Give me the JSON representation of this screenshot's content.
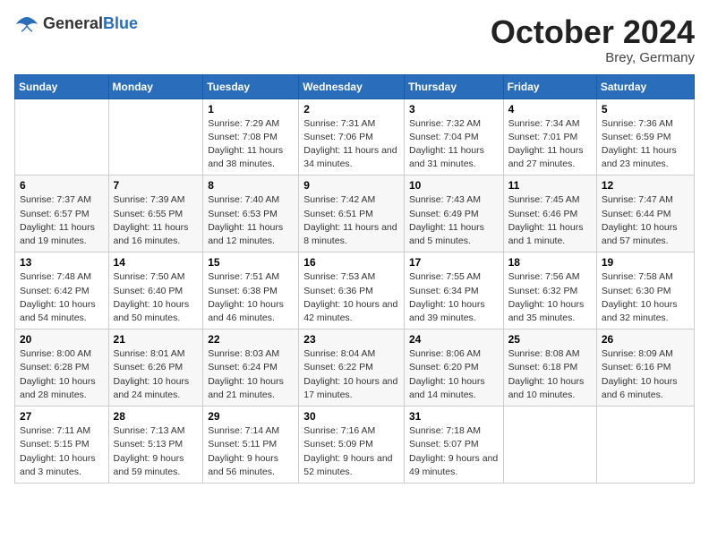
{
  "logo": {
    "text_general": "General",
    "text_blue": "Blue"
  },
  "header": {
    "month": "October 2024",
    "location": "Brey, Germany"
  },
  "weekdays": [
    "Sunday",
    "Monday",
    "Tuesday",
    "Wednesday",
    "Thursday",
    "Friday",
    "Saturday"
  ],
  "weeks": [
    [
      {
        "day": "",
        "sunrise": "",
        "sunset": "",
        "daylight": ""
      },
      {
        "day": "",
        "sunrise": "",
        "sunset": "",
        "daylight": ""
      },
      {
        "day": "1",
        "sunrise": "Sunrise: 7:29 AM",
        "sunset": "Sunset: 7:08 PM",
        "daylight": "Daylight: 11 hours and 38 minutes."
      },
      {
        "day": "2",
        "sunrise": "Sunrise: 7:31 AM",
        "sunset": "Sunset: 7:06 PM",
        "daylight": "Daylight: 11 hours and 34 minutes."
      },
      {
        "day": "3",
        "sunrise": "Sunrise: 7:32 AM",
        "sunset": "Sunset: 7:04 PM",
        "daylight": "Daylight: 11 hours and 31 minutes."
      },
      {
        "day": "4",
        "sunrise": "Sunrise: 7:34 AM",
        "sunset": "Sunset: 7:01 PM",
        "daylight": "Daylight: 11 hours and 27 minutes."
      },
      {
        "day": "5",
        "sunrise": "Sunrise: 7:36 AM",
        "sunset": "Sunset: 6:59 PM",
        "daylight": "Daylight: 11 hours and 23 minutes."
      }
    ],
    [
      {
        "day": "6",
        "sunrise": "Sunrise: 7:37 AM",
        "sunset": "Sunset: 6:57 PM",
        "daylight": "Daylight: 11 hours and 19 minutes."
      },
      {
        "day": "7",
        "sunrise": "Sunrise: 7:39 AM",
        "sunset": "Sunset: 6:55 PM",
        "daylight": "Daylight: 11 hours and 16 minutes."
      },
      {
        "day": "8",
        "sunrise": "Sunrise: 7:40 AM",
        "sunset": "Sunset: 6:53 PM",
        "daylight": "Daylight: 11 hours and 12 minutes."
      },
      {
        "day": "9",
        "sunrise": "Sunrise: 7:42 AM",
        "sunset": "Sunset: 6:51 PM",
        "daylight": "Daylight: 11 hours and 8 minutes."
      },
      {
        "day": "10",
        "sunrise": "Sunrise: 7:43 AM",
        "sunset": "Sunset: 6:49 PM",
        "daylight": "Daylight: 11 hours and 5 minutes."
      },
      {
        "day": "11",
        "sunrise": "Sunrise: 7:45 AM",
        "sunset": "Sunset: 6:46 PM",
        "daylight": "Daylight: 11 hours and 1 minute."
      },
      {
        "day": "12",
        "sunrise": "Sunrise: 7:47 AM",
        "sunset": "Sunset: 6:44 PM",
        "daylight": "Daylight: 10 hours and 57 minutes."
      }
    ],
    [
      {
        "day": "13",
        "sunrise": "Sunrise: 7:48 AM",
        "sunset": "Sunset: 6:42 PM",
        "daylight": "Daylight: 10 hours and 54 minutes."
      },
      {
        "day": "14",
        "sunrise": "Sunrise: 7:50 AM",
        "sunset": "Sunset: 6:40 PM",
        "daylight": "Daylight: 10 hours and 50 minutes."
      },
      {
        "day": "15",
        "sunrise": "Sunrise: 7:51 AM",
        "sunset": "Sunset: 6:38 PM",
        "daylight": "Daylight: 10 hours and 46 minutes."
      },
      {
        "day": "16",
        "sunrise": "Sunrise: 7:53 AM",
        "sunset": "Sunset: 6:36 PM",
        "daylight": "Daylight: 10 hours and 42 minutes."
      },
      {
        "day": "17",
        "sunrise": "Sunrise: 7:55 AM",
        "sunset": "Sunset: 6:34 PM",
        "daylight": "Daylight: 10 hours and 39 minutes."
      },
      {
        "day": "18",
        "sunrise": "Sunrise: 7:56 AM",
        "sunset": "Sunset: 6:32 PM",
        "daylight": "Daylight: 10 hours and 35 minutes."
      },
      {
        "day": "19",
        "sunrise": "Sunrise: 7:58 AM",
        "sunset": "Sunset: 6:30 PM",
        "daylight": "Daylight: 10 hours and 32 minutes."
      }
    ],
    [
      {
        "day": "20",
        "sunrise": "Sunrise: 8:00 AM",
        "sunset": "Sunset: 6:28 PM",
        "daylight": "Daylight: 10 hours and 28 minutes."
      },
      {
        "day": "21",
        "sunrise": "Sunrise: 8:01 AM",
        "sunset": "Sunset: 6:26 PM",
        "daylight": "Daylight: 10 hours and 24 minutes."
      },
      {
        "day": "22",
        "sunrise": "Sunrise: 8:03 AM",
        "sunset": "Sunset: 6:24 PM",
        "daylight": "Daylight: 10 hours and 21 minutes."
      },
      {
        "day": "23",
        "sunrise": "Sunrise: 8:04 AM",
        "sunset": "Sunset: 6:22 PM",
        "daylight": "Daylight: 10 hours and 17 minutes."
      },
      {
        "day": "24",
        "sunrise": "Sunrise: 8:06 AM",
        "sunset": "Sunset: 6:20 PM",
        "daylight": "Daylight: 10 hours and 14 minutes."
      },
      {
        "day": "25",
        "sunrise": "Sunrise: 8:08 AM",
        "sunset": "Sunset: 6:18 PM",
        "daylight": "Daylight: 10 hours and 10 minutes."
      },
      {
        "day": "26",
        "sunrise": "Sunrise: 8:09 AM",
        "sunset": "Sunset: 6:16 PM",
        "daylight": "Daylight: 10 hours and 6 minutes."
      }
    ],
    [
      {
        "day": "27",
        "sunrise": "Sunrise: 7:11 AM",
        "sunset": "Sunset: 5:15 PM",
        "daylight": "Daylight: 10 hours and 3 minutes."
      },
      {
        "day": "28",
        "sunrise": "Sunrise: 7:13 AM",
        "sunset": "Sunset: 5:13 PM",
        "daylight": "Daylight: 9 hours and 59 minutes."
      },
      {
        "day": "29",
        "sunrise": "Sunrise: 7:14 AM",
        "sunset": "Sunset: 5:11 PM",
        "daylight": "Daylight: 9 hours and 56 minutes."
      },
      {
        "day": "30",
        "sunrise": "Sunrise: 7:16 AM",
        "sunset": "Sunset: 5:09 PM",
        "daylight": "Daylight: 9 hours and 52 minutes."
      },
      {
        "day": "31",
        "sunrise": "Sunrise: 7:18 AM",
        "sunset": "Sunset: 5:07 PM",
        "daylight": "Daylight: 9 hours and 49 minutes."
      },
      {
        "day": "",
        "sunrise": "",
        "sunset": "",
        "daylight": ""
      },
      {
        "day": "",
        "sunrise": "",
        "sunset": "",
        "daylight": ""
      }
    ]
  ]
}
